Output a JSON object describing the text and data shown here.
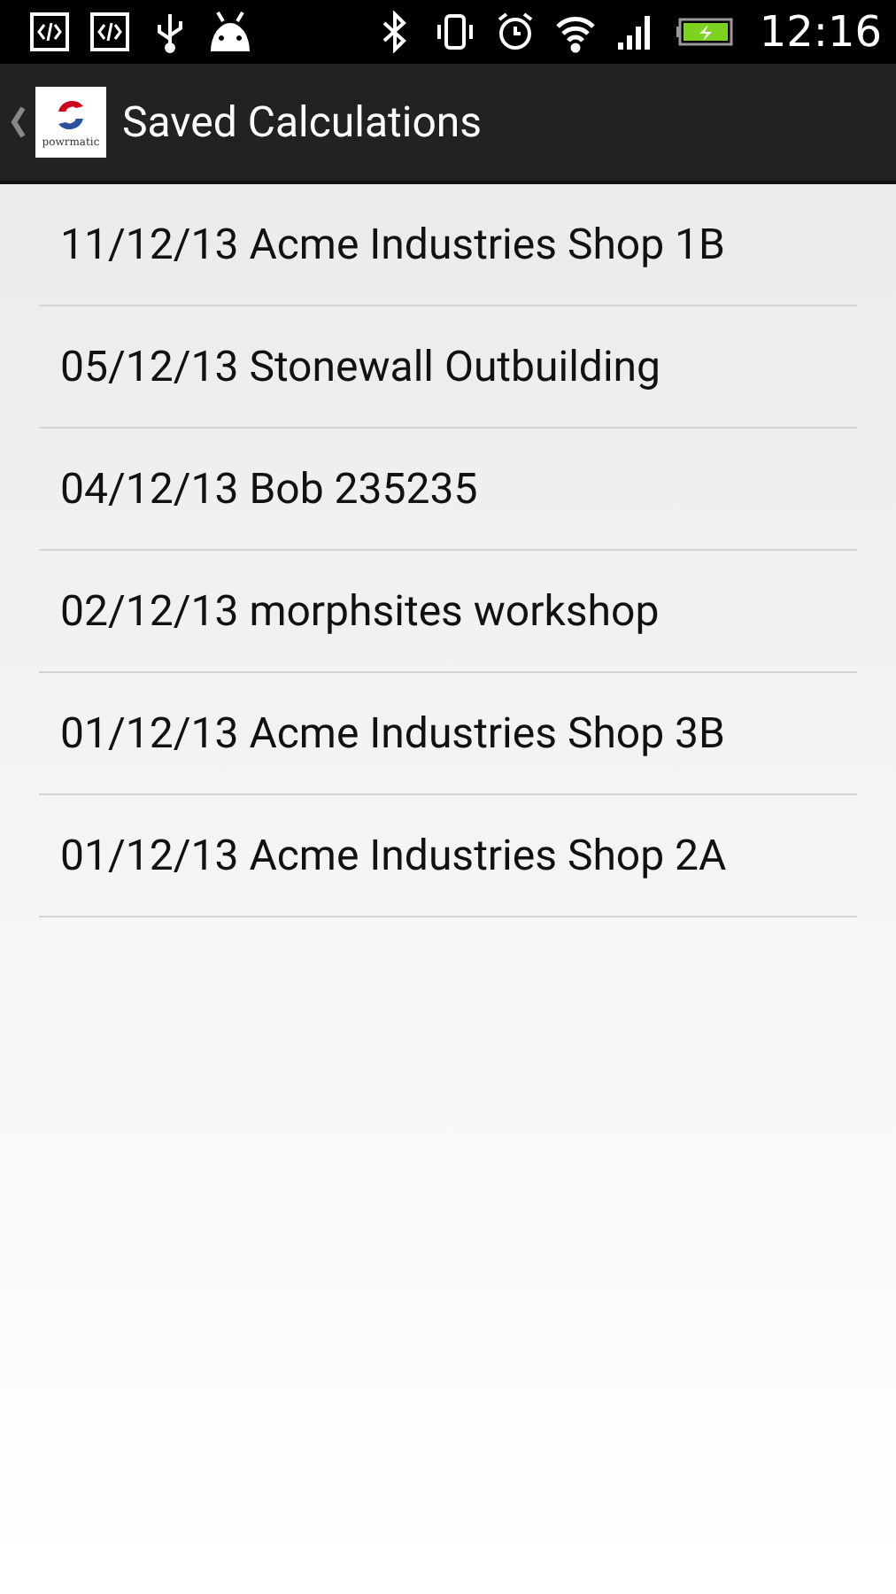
{
  "status_bar": {
    "time": "12:16"
  },
  "action_bar": {
    "logo_text": "powrmatic",
    "title": "Saved Calculations"
  },
  "items": [
    {
      "label": "11/12/13 Acme Industries Shop 1B"
    },
    {
      "label": "05/12/13 Stonewall Outbuilding"
    },
    {
      "label": "04/12/13 Bob 235235"
    },
    {
      "label": "02/12/13 morphsites workshop"
    },
    {
      "label": "01/12/13 Acme Industries Shop 3B"
    },
    {
      "label": "01/12/13 Acme Industries Shop 2A"
    }
  ]
}
